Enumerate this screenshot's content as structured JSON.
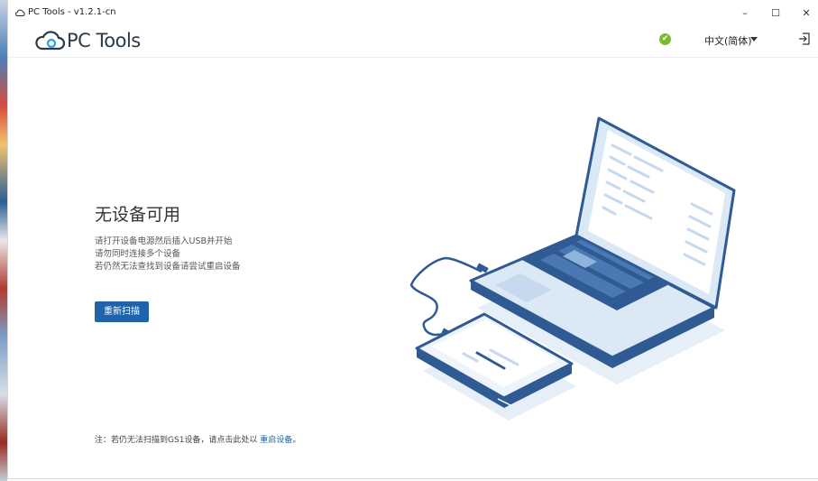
{
  "window": {
    "title": "PC Tools - v1.2.1-cn",
    "minimize": "–",
    "maximize": "☐",
    "close": "✕"
  },
  "header": {
    "logo_text": "PC Tools",
    "status_icon": "check-circle-icon",
    "status_color": "#7cbb2f",
    "language": "中文(简体)",
    "exit_icon": "exit-icon"
  },
  "main": {
    "headline": "无设备可用",
    "instructions": [
      "请打开设备电源然后插入USB并开始",
      "请勿同时连接多个设备",
      "若仍然无法查找到设备请尝试重启设备"
    ],
    "rescan_label": "重新扫描"
  },
  "footer": {
    "note": "注：若仍无法扫描到GS1设备，请点击此处以",
    "link": "重启设备",
    "end": "。"
  },
  "colors": {
    "accent": "#1f63a8",
    "illustration_dark": "#2f5a94",
    "illustration_light": "#d6e6f5"
  }
}
